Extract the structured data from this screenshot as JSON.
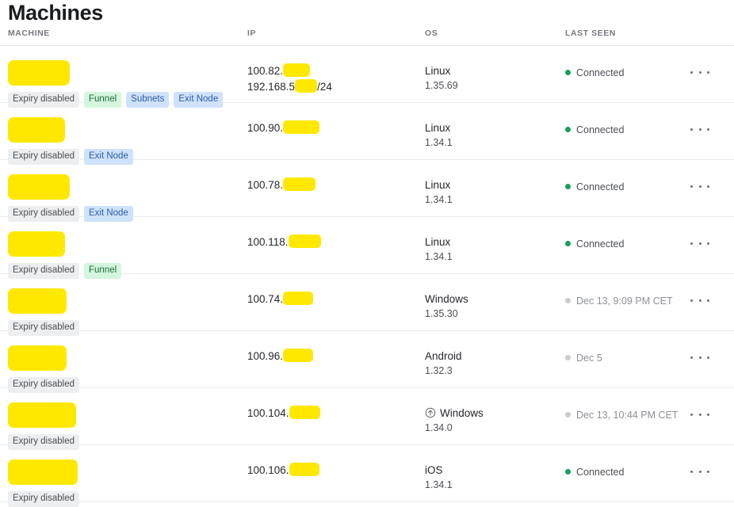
{
  "page": {
    "title": "Machines",
    "watermark": ""
  },
  "table": {
    "columns": [
      {
        "key": "machine",
        "label": "MACHINE"
      },
      {
        "key": "ip",
        "label": "IP"
      },
      {
        "key": "os",
        "label": "OS"
      },
      {
        "key": "last_seen",
        "label": "LAST SEEN"
      }
    ],
    "row_menu_label": "···",
    "rows": [
      {
        "machine": {
          "redacted": true,
          "redact_width": 78
        },
        "tags": [
          {
            "label": "Expiry disabled",
            "style": "neutral"
          },
          {
            "label": "Funnel",
            "style": "green"
          },
          {
            "label": "Subnets",
            "style": "blue"
          },
          {
            "label": "Exit Node",
            "style": "blue"
          }
        ],
        "ip": [
          {
            "prefix": "100.82.",
            "redact_width": 34,
            "suffix": ""
          },
          {
            "prefix": "192.168.5",
            "redact_width": 28,
            "suffix": "/24"
          }
        ],
        "os": {
          "name": "Linux",
          "version": "1.35.69",
          "update_available": false
        },
        "last_seen": {
          "text": "Connected",
          "status": "online"
        }
      },
      {
        "machine": {
          "redacted": true,
          "redact_width": 72
        },
        "tags": [
          {
            "label": "Expiry disabled",
            "style": "neutral"
          },
          {
            "label": "Exit Node",
            "style": "blue"
          }
        ],
        "ip": [
          {
            "prefix": "100.90.",
            "redact_width": 46,
            "suffix": ""
          }
        ],
        "os": {
          "name": "Linux",
          "version": "1.34.1",
          "update_available": false
        },
        "last_seen": {
          "text": "Connected",
          "status": "online"
        }
      },
      {
        "machine": {
          "redacted": true,
          "redact_width": 78
        },
        "tags": [
          {
            "label": "Expiry disabled",
            "style": "neutral"
          },
          {
            "label": "Exit Node",
            "style": "blue"
          }
        ],
        "ip": [
          {
            "prefix": "100.78.",
            "redact_width": 41,
            "suffix": ""
          }
        ],
        "os": {
          "name": "Linux",
          "version": "1.34.1",
          "update_available": false
        },
        "last_seen": {
          "text": "Connected",
          "status": "online"
        }
      },
      {
        "machine": {
          "redacted": true,
          "redact_width": 72
        },
        "tags": [
          {
            "label": "Expiry disabled",
            "style": "neutral"
          },
          {
            "label": "Funnel",
            "style": "green"
          }
        ],
        "ip": [
          {
            "prefix": "100.118.",
            "redact_width": 41,
            "suffix": ""
          }
        ],
        "os": {
          "name": "Linux",
          "version": "1.34.1",
          "update_available": false
        },
        "last_seen": {
          "text": "Connected",
          "status": "online"
        }
      },
      {
        "machine": {
          "redacted": true,
          "redact_width": 74
        },
        "tags": [
          {
            "label": "Expiry disabled",
            "style": "neutral"
          }
        ],
        "ip": [
          {
            "prefix": "100.74.",
            "redact_width": 38,
            "suffix": ""
          }
        ],
        "os": {
          "name": "Windows",
          "version": "1.35.30",
          "update_available": false
        },
        "last_seen": {
          "text": "Dec 13, 9:09 PM CET",
          "status": "offline"
        }
      },
      {
        "machine": {
          "redacted": true,
          "redact_width": 74
        },
        "tags": [
          {
            "label": "Expiry disabled",
            "style": "neutral"
          }
        ],
        "ip": [
          {
            "prefix": "100.96.",
            "redact_width": 38,
            "suffix": ""
          }
        ],
        "os": {
          "name": "Android",
          "version": "1.32.3",
          "update_available": false
        },
        "last_seen": {
          "text": "Dec 5",
          "status": "offline"
        }
      },
      {
        "machine": {
          "redacted": true,
          "redact_width": 86
        },
        "tags": [
          {
            "label": "Expiry disabled",
            "style": "neutral"
          }
        ],
        "ip": [
          {
            "prefix": "100.104.",
            "redact_width": 39,
            "suffix": ""
          }
        ],
        "os": {
          "name": "Windows",
          "version": "1.34.0",
          "update_available": true
        },
        "last_seen": {
          "text": "Dec 13, 10:44 PM CET",
          "status": "offline"
        }
      },
      {
        "machine": {
          "redacted": true,
          "redact_width": 88
        },
        "tags": [
          {
            "label": "Expiry disabled",
            "style": "neutral"
          }
        ],
        "ip": [
          {
            "prefix": "100.106.",
            "redact_width": 38,
            "suffix": ""
          }
        ],
        "os": {
          "name": "iOS",
          "version": "1.34.1",
          "update_available": false
        },
        "last_seen": {
          "text": "Connected",
          "status": "online"
        }
      }
    ]
  },
  "colors": {
    "redaction": "#ffe800",
    "status_online": "#18a058",
    "status_offline": "#c9cbcf",
    "tag_neutral_bg": "#eceef0",
    "tag_green_bg": "#d4f5de",
    "tag_blue_bg": "#cfe2fb"
  }
}
